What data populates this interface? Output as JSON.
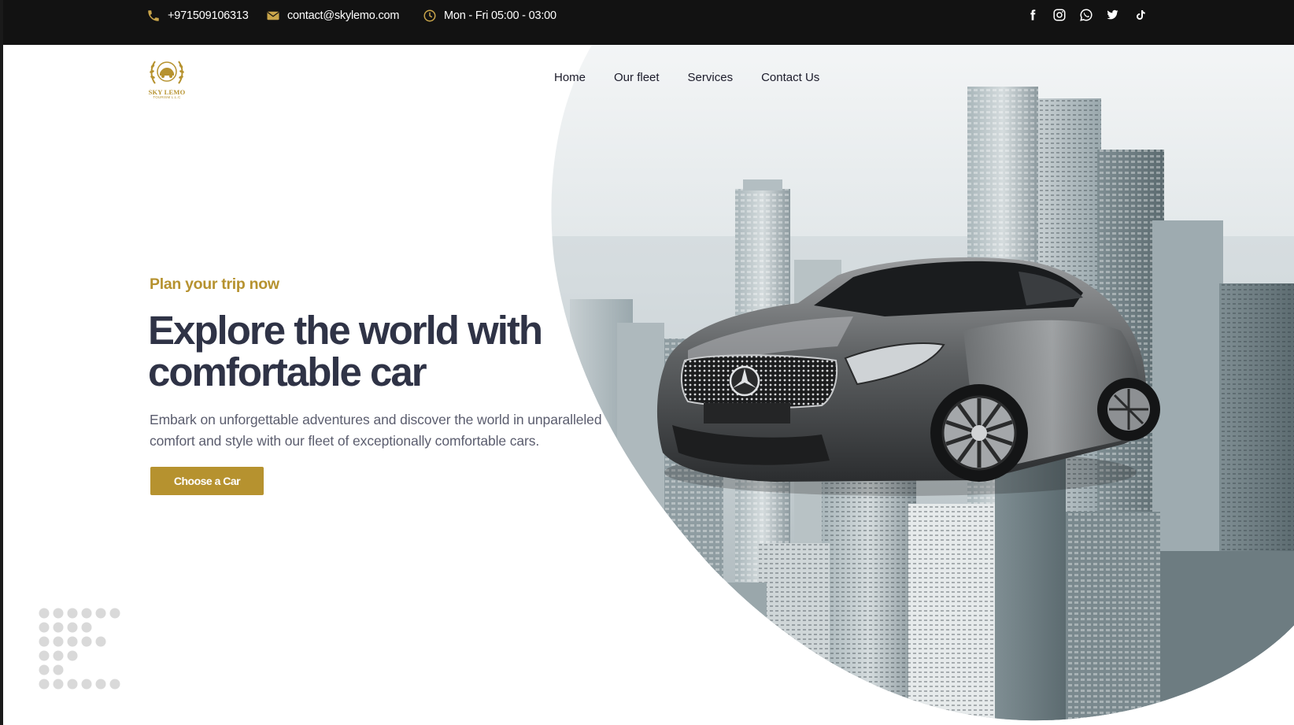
{
  "topbar": {
    "phone": "+971509106313",
    "email": "contact@skylemo.com",
    "hours": "Mon - Fri 05:00 - 03:00",
    "socials": [
      "facebook-icon",
      "instagram-icon",
      "whatsapp-icon",
      "twitter-icon",
      "tiktok-icon"
    ]
  },
  "logo": {
    "brand": "SKY LEMO",
    "tagline": "TOURISM L.L.C"
  },
  "nav": {
    "items": [
      {
        "label": "Home"
      },
      {
        "label": "Our fleet"
      },
      {
        "label": "Services"
      },
      {
        "label": "Contact Us"
      }
    ]
  },
  "hero": {
    "subtitle": "Plan your trip now",
    "title": "Explore the world with comfortable car",
    "description": "Embark on unforgettable adventures and discover the world in unparalleled comfort and style with our fleet of exceptionally comfortable cars.",
    "cta": "Choose a Car"
  },
  "colors": {
    "accent": "#b6922f",
    "topbar": "#121212",
    "heading": "#2f3346",
    "body_text": "#5b5d6e"
  }
}
